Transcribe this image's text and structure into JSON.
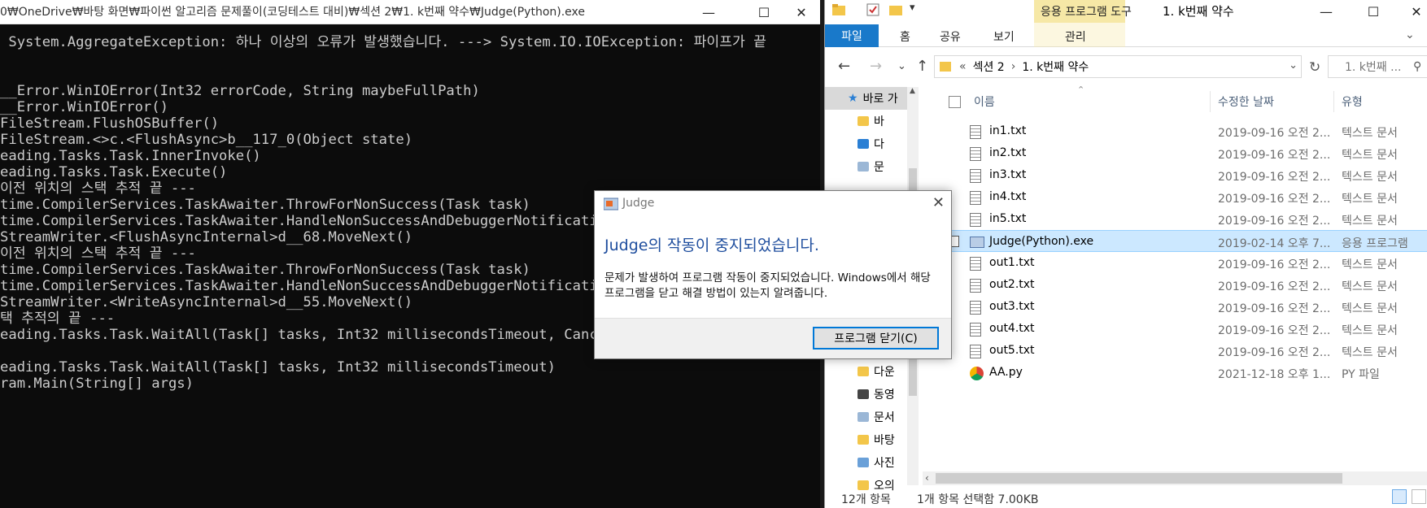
{
  "console": {
    "title": "0₩OneDrive₩바탕 화면₩파이썬 알고리즘 문제풀이(코딩테스트 대비)₩섹션 2₩1. k번째 약수₩Judge(Python).exe",
    "lines": [
      " System.AggregateException: 하나 이상의 오류가 발생했습니다. ---> System.IO.IOException: 파이프가 끝",
      "",
      "",
      "__Error.WinIOError(Int32 errorCode, String maybeFullPath)",
      "__Error.WinIOError()",
      "FileStream.FlushOSBuffer()",
      "FileStream.<>c.<FlushAsync>b__117_0(Object state)",
      "eading.Tasks.Task.InnerInvoke()",
      "eading.Tasks.Task.Execute()",
      "이전 위치의 스택 추적 끝 ---",
      "time.CompilerServices.TaskAwaiter.ThrowForNonSuccess(Task task)",
      "time.CompilerServices.TaskAwaiter.HandleNonSuccessAndDebuggerNotification",
      "StreamWriter.<FlushAsyncInternal>d__68.MoveNext()",
      "이전 위치의 스택 추적 끝 ---",
      "time.CompilerServices.TaskAwaiter.ThrowForNonSuccess(Task task)",
      "time.CompilerServices.TaskAwaiter.HandleNonSuccessAndDebuggerNotification",
      "StreamWriter.<WriteAsyncInternal>d__55.MoveNext()",
      "택 추적의 끝 ---",
      "eading.Tasks.Task.WaitAll(Task[] tasks, Int32 millisecondsTimeout, Cancel",
      "",
      "eading.Tasks.Task.WaitAll(Task[] tasks, Int32 millisecondsTimeout)",
      "ram.Main(String[] args)"
    ]
  },
  "explorer": {
    "context_tab": "응용 프로그램 도구",
    "title": "1. k번째 약수",
    "tabs": {
      "file": "파일",
      "home": "홈",
      "share": "공유",
      "view": "보기",
      "manage": "관리"
    },
    "breadcrumb": {
      "overflow": "«",
      "section": "섹션 2",
      "current": "1. k번째 약수"
    },
    "search_placeholder": "1. k번째 ...",
    "nav": [
      {
        "label": "바로 가",
        "icon": "star-icon"
      },
      {
        "label": "바",
        "icon": "folder-icon"
      },
      {
        "label": "다",
        "icon": "download-icon"
      },
      {
        "label": "문",
        "icon": "document-icon"
      },
      {
        "label": "다운",
        "icon": "folder-icon"
      },
      {
        "label": "동영",
        "icon": "video-icon"
      },
      {
        "label": "문서",
        "icon": "document-icon"
      },
      {
        "label": "바탕",
        "icon": "folder-icon"
      },
      {
        "label": "사진",
        "icon": "picture-icon"
      },
      {
        "label": "오의",
        "icon": "folder-icon"
      }
    ],
    "columns": {
      "name": "이름",
      "modified": "수정한 날짜",
      "type": "유형"
    },
    "files": [
      {
        "name": "in1.txt",
        "modified": "2019-09-16 오전 2...",
        "type": "텍스트 문서",
        "icon": "text-file-icon"
      },
      {
        "name": "in2.txt",
        "modified": "2019-09-16 오전 2...",
        "type": "텍스트 문서",
        "icon": "text-file-icon"
      },
      {
        "name": "in3.txt",
        "modified": "2019-09-16 오전 2...",
        "type": "텍스트 문서",
        "icon": "text-file-icon"
      },
      {
        "name": "in4.txt",
        "modified": "2019-09-16 오전 2...",
        "type": "텍스트 문서",
        "icon": "text-file-icon"
      },
      {
        "name": "in5.txt",
        "modified": "2019-09-16 오전 2...",
        "type": "텍스트 문서",
        "icon": "text-file-icon"
      },
      {
        "name": "Judge(Python).exe",
        "modified": "2019-02-14 오후 7...",
        "type": "응용 프로그램",
        "icon": "app-icon",
        "selected": true
      },
      {
        "name": "out1.txt",
        "modified": "2019-09-16 오전 2...",
        "type": "텍스트 문서",
        "icon": "text-file-icon"
      },
      {
        "name": "out2.txt",
        "modified": "2019-09-16 오전 2...",
        "type": "텍스트 문서",
        "icon": "text-file-icon"
      },
      {
        "name": "out3.txt",
        "modified": "2019-09-16 오전 2...",
        "type": "텍스트 문서",
        "icon": "text-file-icon"
      },
      {
        "name": "out4.txt",
        "modified": "2019-09-16 오전 2...",
        "type": "텍스트 문서",
        "icon": "text-file-icon"
      },
      {
        "name": "out5.txt",
        "modified": "2019-09-16 오전 2...",
        "type": "텍스트 문서",
        "icon": "text-file-icon"
      },
      {
        "name": "AA.py",
        "modified": "2021-12-18 오후 1...",
        "type": "PY 파일",
        "icon": "chrome-icon"
      }
    ],
    "status": {
      "count": "12개 항목",
      "selection": "1개 항목 선택함 7.00KB"
    }
  },
  "dialog": {
    "title": "Judge",
    "heading": "Judge의 작동이 중지되었습니다.",
    "body": "문제가 발생하여 프로그램 작동이 중지되었습니다. Windows에서 해당 프로그램을 닫고 해결 방법이 있는지 알려줍니다.",
    "button": "프로그램 닫기(C)"
  },
  "colors": {
    "accent": "#1979ca",
    "selected_row": "#cce8ff",
    "context_tab": "#f6e8a6",
    "dialog_heading": "#1f4e9e"
  }
}
